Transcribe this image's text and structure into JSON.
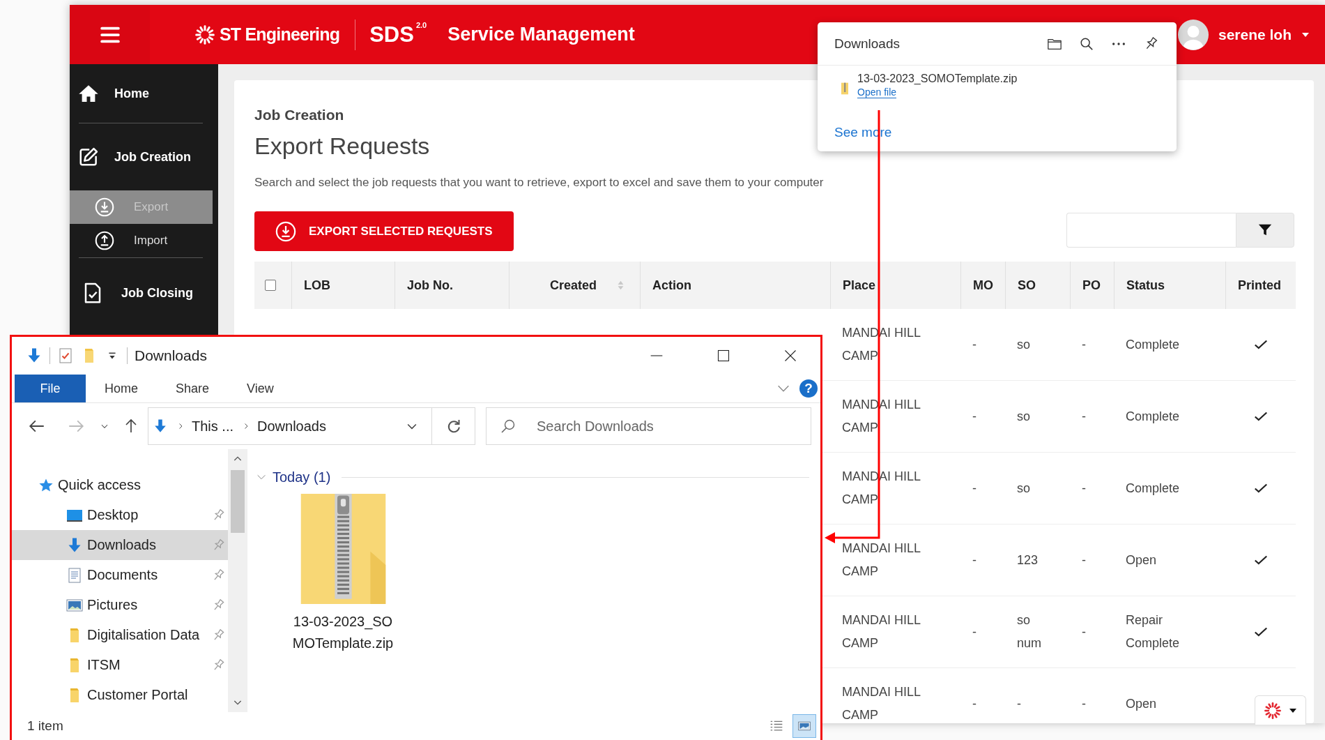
{
  "header": {
    "brand": "ST Engineering",
    "product": "SDS$^{2.0}$",
    "title": "Service Management",
    "user": "serene loh"
  },
  "sidebar": {
    "items": [
      {
        "label": "Home",
        "selected": false
      },
      {
        "label": "Job Creation",
        "selected": false,
        "children": [
          {
            "label": "Export",
            "selected": true
          },
          {
            "label": "Import",
            "selected": false
          }
        ]
      },
      {
        "label": "Job Closing",
        "selected": false
      }
    ]
  },
  "page": {
    "breadcrumb": "Job Creation",
    "title": "Export Requests",
    "description": "Search and select the job requests that you want to retrieve, export to excel and save them to your computer",
    "export_button": "EXPORT SELECTED REQUESTS"
  },
  "table": {
    "select_all": {
      "checked": false
    },
    "columns": [
      {
        "label": "LOB"
      },
      {
        "label": "Job No."
      },
      {
        "label": "Created",
        "sortable": true
      },
      {
        "label": "Action"
      },
      {
        "label": "Place"
      },
      {
        "label": "MO"
      },
      {
        "label": "SO"
      },
      {
        "label": "PO"
      },
      {
        "label": "Status"
      },
      {
        "label": "Printed"
      }
    ],
    "rows": [
      {
        "place": "MANDAI HILL CAMP",
        "mo": "-",
        "so": "so",
        "po": "-",
        "status": "Complete",
        "printed": true
      },
      {
        "place": "MANDAI HILL CAMP",
        "mo": "-",
        "so": "so",
        "po": "-",
        "status": "Complete",
        "printed": true
      },
      {
        "place": "MANDAI HILL CAMP",
        "mo": "-",
        "so": "so",
        "po": "-",
        "status": "Complete",
        "printed": true
      },
      {
        "place": "MANDAI HILL CAMP",
        "mo": "-",
        "so": "123",
        "po": "-",
        "status": "Open",
        "printed": true
      },
      {
        "place": "MANDAI HILL CAMP",
        "mo": "-",
        "so": "so num",
        "po": "-",
        "status": "Repair Complete",
        "printed": true
      },
      {
        "place": "MANDAI HILL CAMP",
        "mo": "-",
        "so": "-",
        "po": "-",
        "status": "Open"
      }
    ]
  },
  "downloads_popup": {
    "title": "Downloads",
    "file_name": "13-03-2023_SOMOTemplate.zip",
    "open_link": "Open file",
    "see_more": "See more"
  },
  "explorer": {
    "title": "Downloads",
    "ribbon_tabs": [
      {
        "label": "File",
        "selected": true
      },
      {
        "label": "Home",
        "selected": false
      },
      {
        "label": "Share",
        "selected": false
      },
      {
        "label": "View",
        "selected": false
      }
    ],
    "help": "?",
    "address": [
      "This ...",
      "Downloads"
    ],
    "search": {
      "placeholder": "Search Downloads"
    },
    "nav": [
      {
        "label": "Quick access",
        "selected": false,
        "children": [
          {
            "label": "Desktop",
            "pinned": true,
            "selected": false
          },
          {
            "label": "Downloads",
            "pinned": true,
            "selected": true
          },
          {
            "label": "Documents",
            "pinned": true,
            "selected": false
          },
          {
            "label": "Pictures",
            "pinned": true,
            "selected": false
          },
          {
            "label": "Digitalisation Data",
            "pinned": true,
            "selected": false
          },
          {
            "label": "ITSM",
            "pinned": true,
            "selected": false
          },
          {
            "label": "Customer Portal",
            "pinned": false,
            "selected": false
          }
        ]
      }
    ],
    "group": "Today (1)",
    "files": [
      {
        "name": "13-03-2023_SOMOTemplate.zip"
      }
    ],
    "status": "1 item",
    "view_buttons": [
      {
        "selected": false
      },
      {
        "selected": true
      }
    ]
  }
}
